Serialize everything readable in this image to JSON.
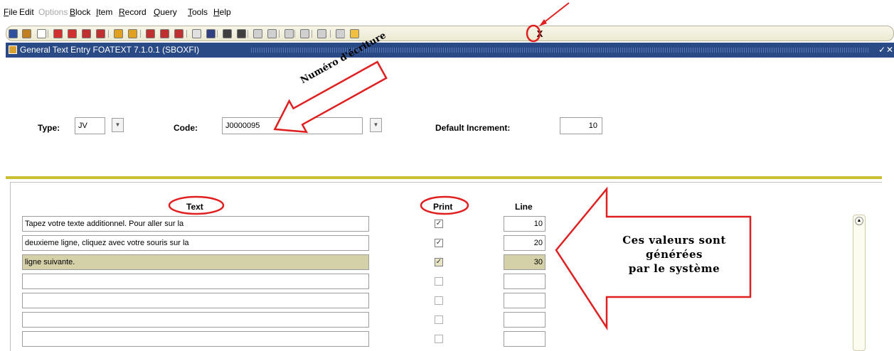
{
  "menu": {
    "items": [
      {
        "label": "File",
        "u": "F",
        "disabled": false
      },
      {
        "label": "Edit",
        "u": "",
        "disabled": false
      },
      {
        "label": "Options",
        "u": "",
        "disabled": true
      },
      {
        "label": "Block",
        "u": "B",
        "disabled": false
      },
      {
        "label": "Item",
        "u": "I",
        "disabled": false
      },
      {
        "label": "Record",
        "u": "R",
        "disabled": false
      },
      {
        "label": "Query",
        "u": "Q",
        "disabled": false
      },
      {
        "label": "Tools",
        "u": "T",
        "disabled": false
      },
      {
        "label": "Help",
        "u": "H",
        "disabled": false
      }
    ]
  },
  "toolbar": {
    "exit_label": "X",
    "icons": [
      "save-icon",
      "rollback-icon",
      "print-icon",
      "insert-record-icon",
      "remove-record-icon",
      "previous-block-icon",
      "next-block-icon",
      "previous-record-icon",
      "next-record-icon",
      "enter-query-icon",
      "execute-query-icon",
      "cancel-query-icon",
      "help-icon",
      "print-form-icon",
      "count-hits-icon",
      "list-values-icon",
      "options-icon",
      "item-help-icon",
      "related-icon",
      "tools-icon",
      "extract-icon",
      "online-help-icon",
      "lamp-icon"
    ]
  },
  "window": {
    "title": "General Text Entry  FOATEXT  7.1.0.1  (SBOXFI)"
  },
  "key_block": {
    "type_label": "Type:",
    "type_value": "JV",
    "code_label": "Code:",
    "code_value": "J0000095",
    "increment_label": "Default Increment:",
    "increment_value": "10"
  },
  "text_block": {
    "headers": {
      "text": "Text",
      "print": "Print",
      "line": "Line"
    },
    "rows": [
      {
        "text": "Tapez votre texte additionnel.  Pour aller sur la",
        "print": true,
        "line": "10",
        "selected": false
      },
      {
        "text": "deuxieme ligne, cliquez avec votre souris sur la",
        "print": true,
        "line": "20",
        "selected": false
      },
      {
        "text": "ligne suivante.",
        "print": true,
        "line": "30",
        "selected": true
      },
      {
        "text": "",
        "print": false,
        "line": "",
        "selected": false
      },
      {
        "text": "",
        "print": false,
        "line": "",
        "selected": false
      },
      {
        "text": "",
        "print": false,
        "line": "",
        "selected": false
      },
      {
        "text": "",
        "print": false,
        "line": "",
        "selected": false
      }
    ]
  },
  "annotations": {
    "numero": "Numéro d'écriture",
    "callout_lines": [
      "Ces valeurs sont",
      "générées",
      "par le système"
    ]
  },
  "colors": {
    "title_bar": "#2a4a86",
    "divider": "#c8c030",
    "annotation": "#e02020",
    "selected_row": "#d4d0a8"
  }
}
